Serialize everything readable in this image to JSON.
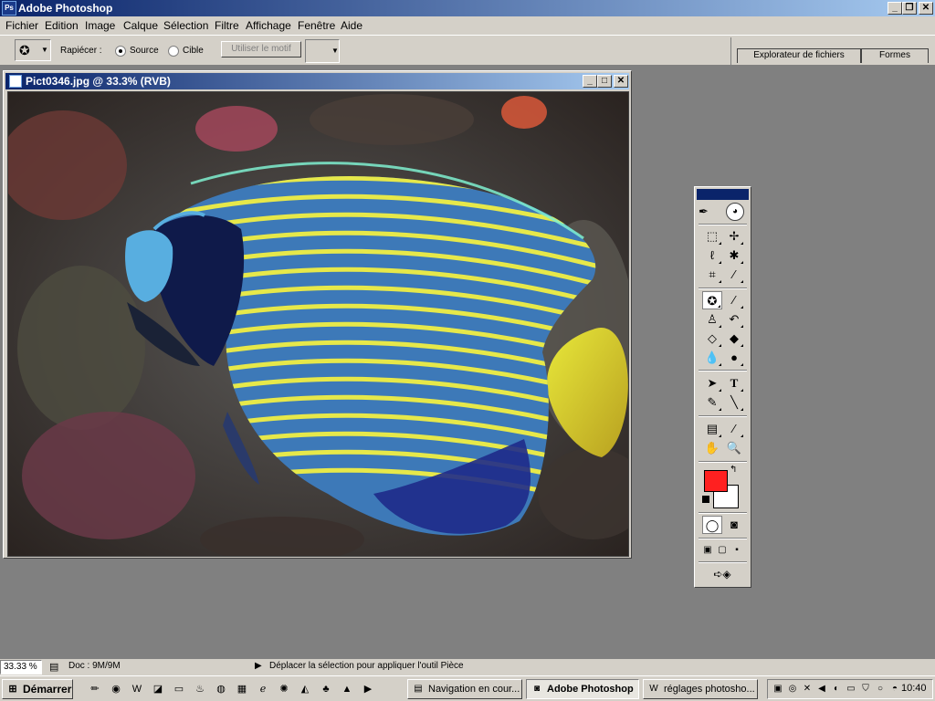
{
  "app": {
    "title": "Adobe Photoshop",
    "icon": "photoshop-icon"
  },
  "window_controls": {
    "minimize": "_",
    "restore": "❐",
    "close": "✕"
  },
  "menu": {
    "items": [
      "Fichier",
      "Edition",
      "Image",
      "Calque",
      "Sélection",
      "Filtre",
      "Affichage",
      "Fenêtre",
      "Aide"
    ]
  },
  "options_bar": {
    "patch_label": "Rapiécer :",
    "source_label": "Source",
    "target_label": "Cible",
    "selected_mode": "Source",
    "use_pattern_button": "Utiliser le motif",
    "file_browser_tab": "Explorateur de fichiers",
    "brushes_tab": "Formes"
  },
  "document": {
    "title": "Pict0346.jpg @ 33.3% (RVB)",
    "image_description_icon": "emperor-angelfish-photo"
  },
  "toolbox": {
    "foreground_color": "#ff2020",
    "background_color": "#ffffff",
    "tools": [
      "marquee-tool-icon",
      "move-tool-icon",
      "lasso-tool-icon",
      "magic-wand-tool-icon",
      "crop-tool-icon",
      "slice-tool-icon",
      "patch-tool-icon",
      "brush-tool-icon",
      "clone-stamp-tool-icon",
      "history-brush-tool-icon",
      "eraser-tool-icon",
      "paint-bucket-tool-icon",
      "blur-tool-icon",
      "dodge-tool-icon",
      "path-selection-tool-icon",
      "type-tool-icon",
      "pen-tool-icon",
      "line-tool-icon",
      "notes-tool-icon",
      "eyedropper-tool-icon",
      "hand-tool-icon",
      "zoom-tool-icon"
    ],
    "active_tool": "patch-tool-icon"
  },
  "status_bar": {
    "zoom": "33.33 %",
    "doc_size": "Doc : 9M/9M",
    "hint": "Déplacer la sélection pour appliquer l'outil Pièce"
  },
  "taskbar": {
    "start_label": "Démarrer",
    "tasks": [
      {
        "label": "Navigation en cour...",
        "icon": "folder-icon",
        "active": false
      },
      {
        "label": "Adobe Photoshop",
        "icon": "photoshop-icon",
        "active": true
      },
      {
        "label": "réglages photosho...",
        "icon": "word-document-icon",
        "active": false
      }
    ],
    "clock": "10:40"
  }
}
